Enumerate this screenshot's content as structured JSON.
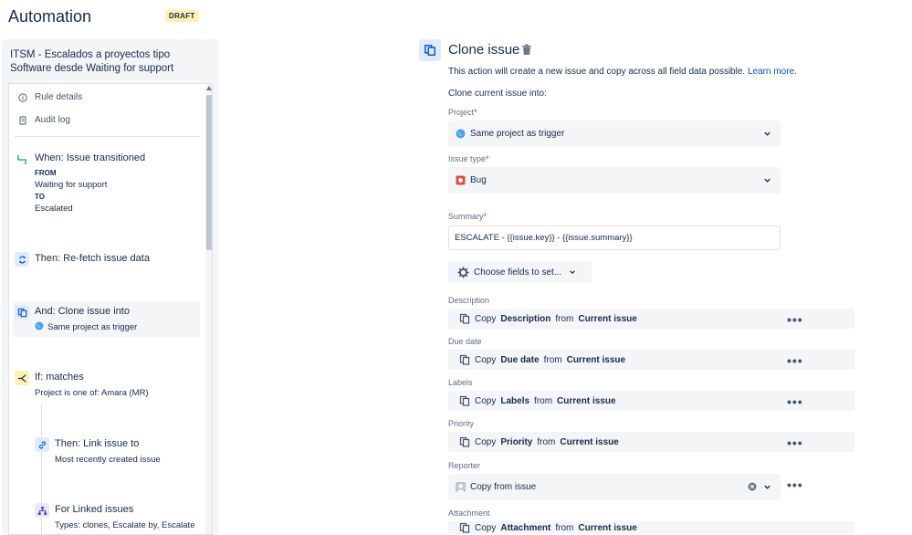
{
  "header": {
    "title": "Automation",
    "badge": "DRAFT"
  },
  "rule": {
    "name": "ITSM - Escalados a proyectos tipo Software desde Waiting for support",
    "nav": [
      {
        "icon": "info-icon",
        "label": "Rule details"
      },
      {
        "icon": "document-icon",
        "label": "Audit log"
      }
    ],
    "steps": {
      "trigger": {
        "title": "When: Issue transitioned",
        "from_label": "FROM",
        "from_value": "Waiting for support",
        "to_label": "TO",
        "to_value": "Escalated"
      },
      "refetch": {
        "title": "Then: Re-fetch issue data"
      },
      "clone": {
        "title": "And: Clone issue into",
        "sub": "Same project as trigger"
      },
      "condition": {
        "title": "If: matches",
        "sub": "Project is one of: Amara (MR)"
      },
      "link": {
        "title": "Then: Link issue to",
        "sub": "Most recently created issue"
      },
      "linked": {
        "title": "For Linked issues",
        "sub": "Types: clones, Escalate by, Escalate"
      }
    }
  },
  "config": {
    "title": "Clone issue",
    "description": "This action will create a new issue and copy across all field data possible.",
    "learn_more": "Learn more.",
    "clone_into_label": "Clone current issue into:",
    "project_label": "Project",
    "project_value": "Same project as trigger",
    "issue_type_label": "Issue type",
    "issue_type_value": "Bug",
    "summary_label": "Summary",
    "summary_value": "ESCALATE - {{issue.key}} - {{issue.summary}}",
    "choose_fields": "Choose fields to set...",
    "copy_word": "Copy",
    "from_word": "from",
    "fields": [
      {
        "label": "Description",
        "field": "Description",
        "source": "Current issue"
      },
      {
        "label": "Due date",
        "field": "Due date",
        "source": "Current issue"
      },
      {
        "label": "Labels",
        "field": "Labels",
        "source": "Current issue"
      },
      {
        "label": "Priority",
        "field": "Priority",
        "source": "Current issue"
      },
      {
        "label": "Attachment",
        "field": "Attachment",
        "source": "Current issue"
      }
    ],
    "reporter_label": "Reporter",
    "reporter_value": "Copy from issue",
    "required_mark": "*",
    "more_label": "•••"
  },
  "colors": {
    "link": "#0052cc",
    "required": "#de350b",
    "draft_badge": "#fff0b3",
    "selected_step": "#f4f5f7",
    "bug": "#e5493a"
  }
}
